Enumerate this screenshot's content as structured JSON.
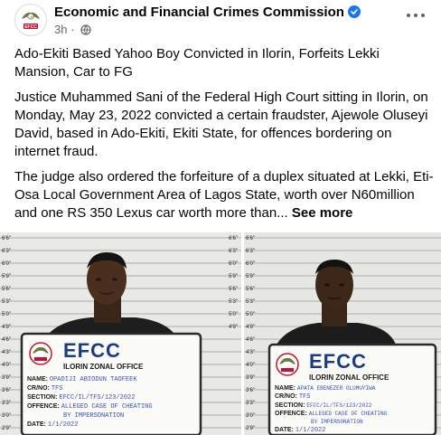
{
  "header": {
    "page_name": "Economic and Financial Crimes Commission",
    "time": "3h",
    "separator": "·"
  },
  "post": {
    "headline": "Ado-Ekiti Based Yahoo Boy Convicted in Ilorin, Forfeits Lekki Mansion, Car to FG",
    "paragraph1": "Justice Muhammed Sani of the Federal High Court sitting in Ilorin, on Monday, May 23, 2022 convicted a certain fraudster, Ajewole Oluseyi David, based in Ado-Ekiti, Ekiti State, for offences bordering on internet fraud.",
    "paragraph2": "The judge also ordered the forfeiture of a duplex situated at Lekki, Eti-Osa Local Government Area of Lagos State, worth over N60million and one RS 350 Lexus car worth more than...",
    "see_more": "See more"
  },
  "photos": {
    "left": {
      "placard_title": "EFCC",
      "office": "ILORIN ZONAL OFFICE",
      "name_label": "NAME:",
      "name_value": "OPADIJI ABIODUN TAOFEEK",
      "crno_label": "CR/NO:",
      "crno_value": "TFS",
      "section_label": "SECTION:",
      "section_value": "EFCC/IL/TFS/123/2022",
      "offence_label": "OFFENCE:",
      "offence_value": "ALLEGED CASE OF CHEATING",
      "offence_value2": "BY IMPERSONATION",
      "date_label": "DATE:",
      "date_value": "1/1/2022",
      "ruler_labels": [
        "6'6\"",
        "6'3\"",
        "6'0\"",
        "5'9\"",
        "5'6\"",
        "5'3\"",
        "5'0\"",
        "4'9\"",
        "4'6\"",
        "4'3\"",
        "4'0\"",
        "3'9\"",
        "3'6\"",
        "3'3\"",
        "3'0\"",
        "2'9\""
      ]
    },
    "right": {
      "placard_title": "EFCC",
      "office": "ILORIN ZONAL OFFICE",
      "name_label": "NAME:",
      "name_value": "APATA EBENEZER OLUMUYIWA",
      "crno_label": "CR/NO:",
      "crno_value": "TFS",
      "section_label": "SECTION:",
      "section_value": "EFCC/IL/TFS/123/2022",
      "offence_label": "OFFENCE:",
      "offence_value": "ALLEGED CASE OF CHEATING",
      "offence_value2": "BY IMPERSONATION",
      "date_label": "DATE:",
      "date_value": "1/1/2022",
      "ruler_labels": [
        "6'6\"",
        "6'3\"",
        "6'0\"",
        "5'9\"",
        "5'6\"",
        "5'3\"",
        "5'0\"",
        "4'9\"",
        "4'6\"",
        "4'3\"",
        "4'0\"",
        "3'9\"",
        "3'6\"",
        "3'3\"",
        "3'0\"",
        "2'9\""
      ]
    }
  },
  "colors": {
    "verified_badge": "#1877f2",
    "placard_title": "#1a3a8a",
    "placard_border": "#2a2a2a",
    "handwriting": "#3b4fb0"
  }
}
